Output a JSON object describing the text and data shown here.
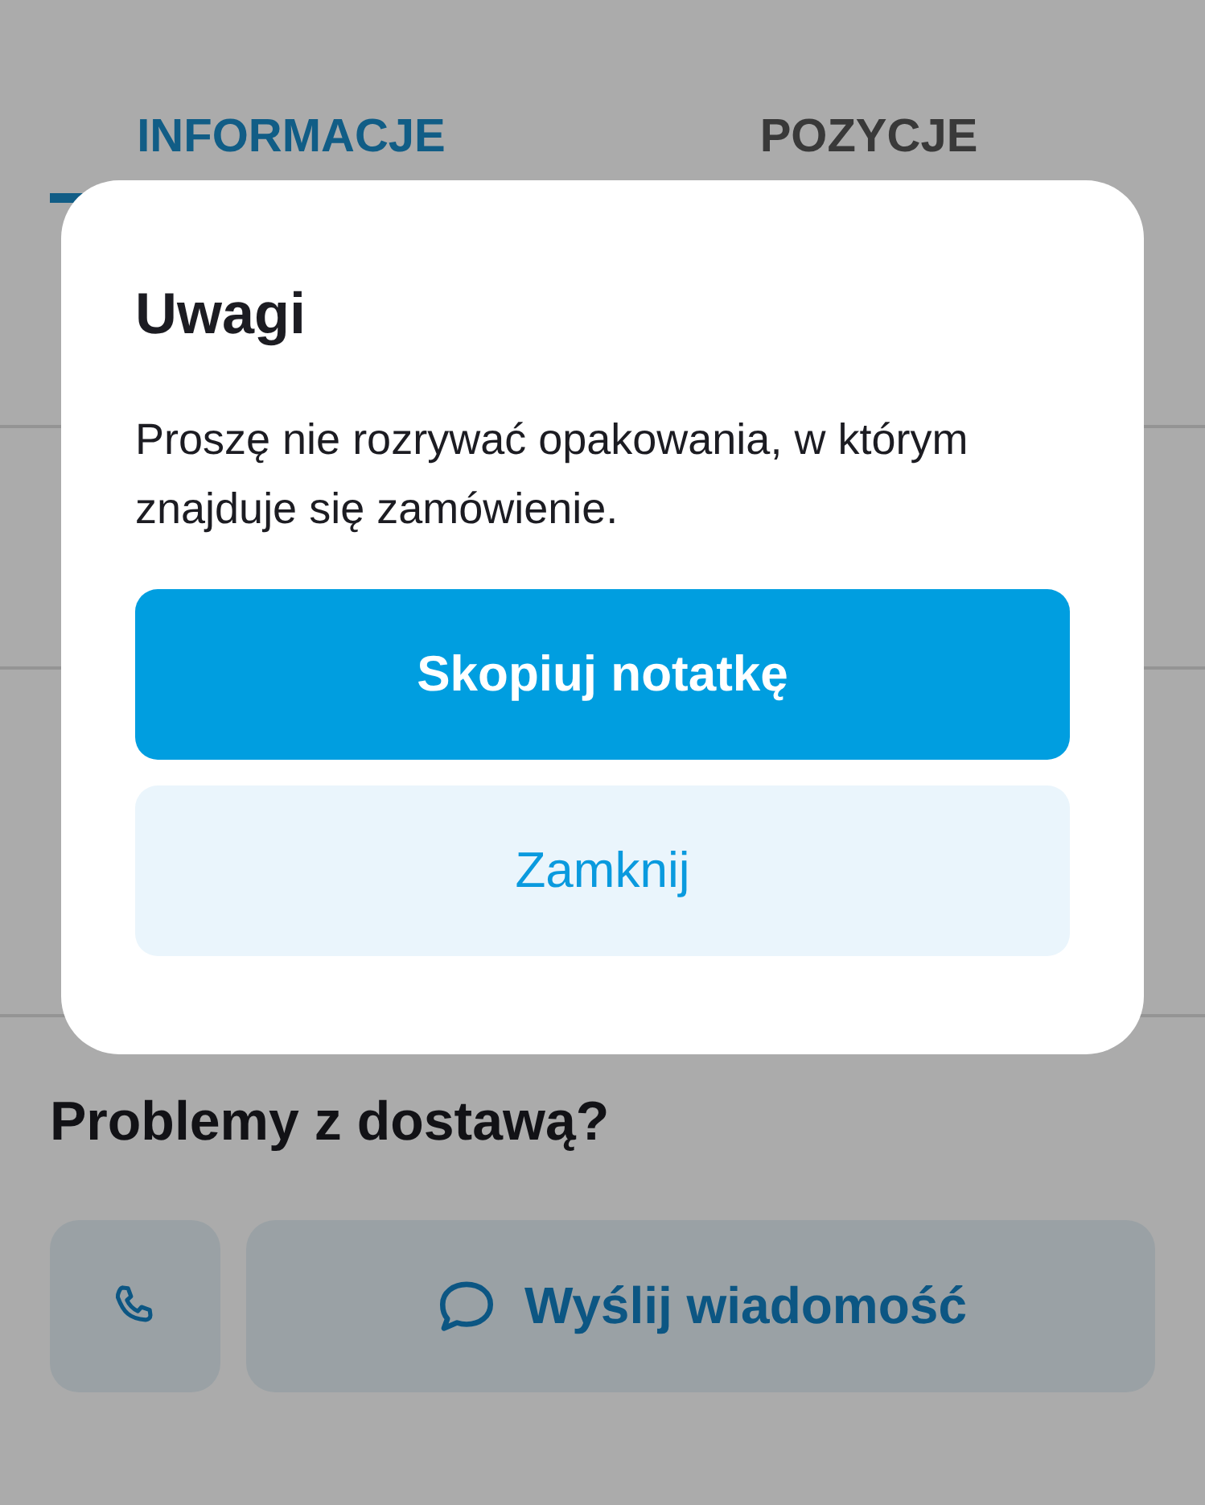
{
  "tabs": [
    {
      "label": "INFORMACJE",
      "selected": true
    },
    {
      "label": "POZYCJE",
      "selected": false
    }
  ],
  "support": {
    "title": "Problemy z dostawą?",
    "buttons": [
      {
        "kind": "call"
      },
      {
        "kind": "message",
        "label": "Wyślij wiadomość"
      }
    ]
  },
  "dialog": {
    "title": "Uwagi",
    "message": "Proszę nie rozrywać opakowania, w którym znajduje się zamówienie.",
    "buttons": [
      {
        "kind": "primary",
        "label": "Skopiuj notatkę"
      },
      {
        "kind": "secondary",
        "label": "Zamknij"
      }
    ]
  }
}
